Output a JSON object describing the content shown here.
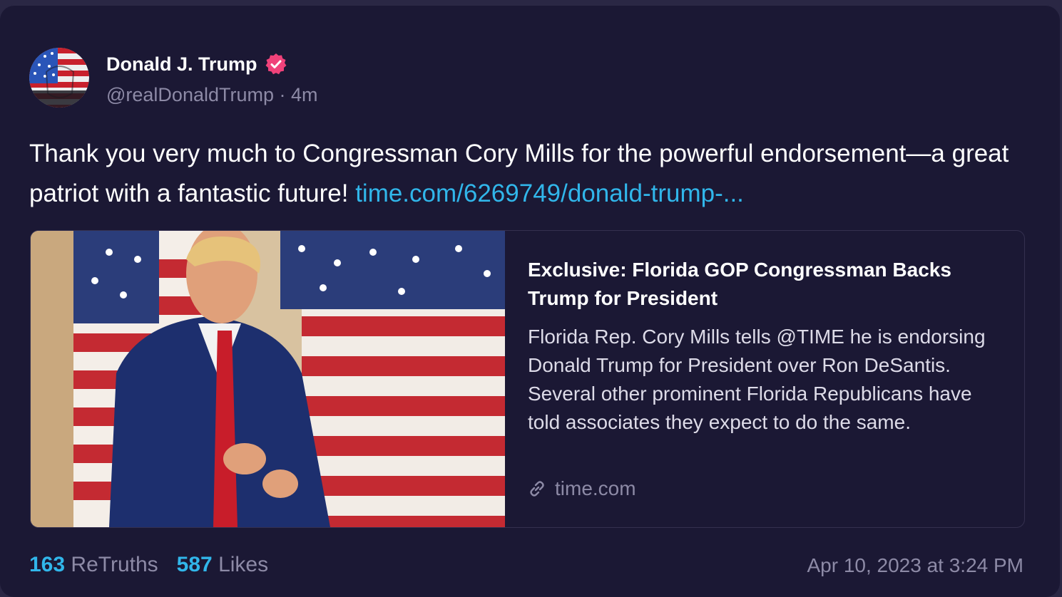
{
  "post": {
    "display_name": "Donald J. Trump",
    "handle": "@realDonaldTrump",
    "separator": "·",
    "time_ago": "4m",
    "text": "Thank you very much to Congressman Cory Mills for the powerful endorsement—a great patriot with a fantastic future!",
    "link_text": "time.com/6269749/donald-trump-...",
    "verified": true
  },
  "preview": {
    "title": "Exclusive: Florida GOP Congressman Backs Trump for President",
    "description": "Florida Rep. Cory Mills tells @TIME he is endorsing Donald Trump for President over Ron DeSantis. Several other prominent Florida Republicans have told associates they expect to do the same.",
    "domain": "time.com",
    "domain_icon": "link-icon"
  },
  "stats": {
    "retruths_count": "163",
    "retruths_label": "ReTruths",
    "likes_count": "587",
    "likes_label": "Likes"
  },
  "timestamp": "Apr 10, 2023 at 3:24 PM",
  "colors": {
    "background": "#1b1834",
    "accent": "#31b6ea",
    "verified": "#f0427a",
    "muted": "#8d8aa6"
  }
}
